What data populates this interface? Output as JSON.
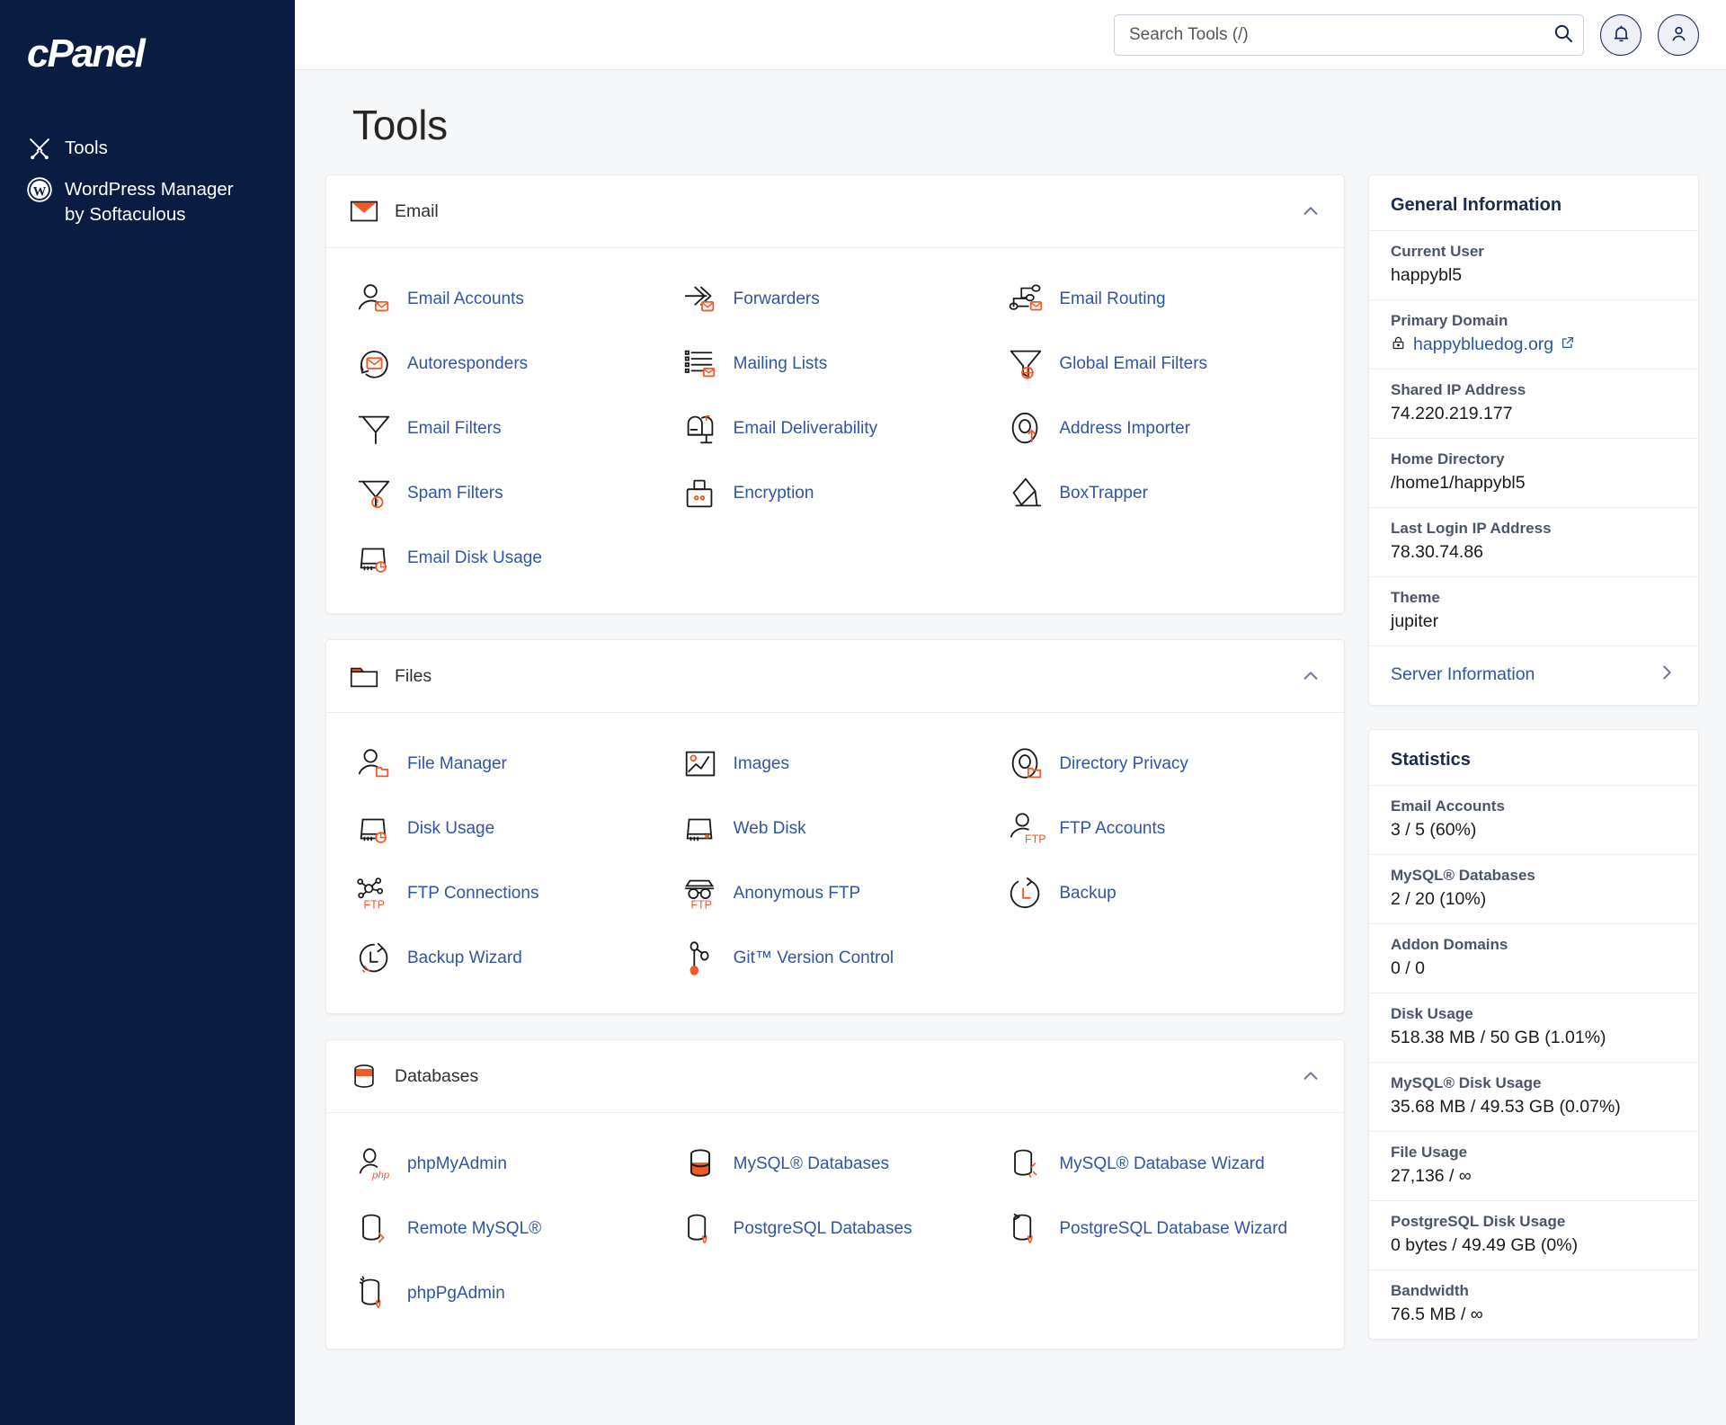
{
  "brand": {
    "name": "cPanel"
  },
  "sidebar": {
    "items": [
      {
        "label": "Tools",
        "icon": "tools-icon",
        "sub": ""
      },
      {
        "label": "WordPress Manager",
        "icon": "wordpress-icon",
        "sub": "by Softaculous"
      }
    ]
  },
  "topbar": {
    "search": {
      "placeholder": "Search Tools (/)",
      "value": "",
      "icon": "search-icon"
    },
    "notifications_icon": "bell-icon",
    "account_icon": "user-icon"
  },
  "page": {
    "title": "Tools"
  },
  "sections": [
    {
      "id": "email",
      "title": "Email",
      "icon": "envelope-icon",
      "collapse_icon": "chevron-up-icon",
      "tools": [
        {
          "label": "Email Accounts",
          "icon": "email-accounts-icon"
        },
        {
          "label": "Forwarders",
          "icon": "forwarders-icon"
        },
        {
          "label": "Email Routing",
          "icon": "email-routing-icon"
        },
        {
          "label": "Autoresponders",
          "icon": "autoresponders-icon"
        },
        {
          "label": "Mailing Lists",
          "icon": "mailing-lists-icon"
        },
        {
          "label": "Global Email Filters",
          "icon": "global-email-filters-icon"
        },
        {
          "label": "Email Filters",
          "icon": "email-filters-icon"
        },
        {
          "label": "Email Deliverability",
          "icon": "email-deliverability-icon"
        },
        {
          "label": "Address Importer",
          "icon": "address-importer-icon"
        },
        {
          "label": "Spam Filters",
          "icon": "spam-filters-icon"
        },
        {
          "label": "Encryption",
          "icon": "encryption-icon"
        },
        {
          "label": "BoxTrapper",
          "icon": "boxtrapper-icon"
        },
        {
          "label": "Email Disk Usage",
          "icon": "email-disk-usage-icon"
        }
      ]
    },
    {
      "id": "files",
      "title": "Files",
      "icon": "folder-icon",
      "collapse_icon": "chevron-up-icon",
      "tools": [
        {
          "label": "File Manager",
          "icon": "file-manager-icon"
        },
        {
          "label": "Images",
          "icon": "images-icon"
        },
        {
          "label": "Directory Privacy",
          "icon": "directory-privacy-icon"
        },
        {
          "label": "Disk Usage",
          "icon": "disk-usage-icon"
        },
        {
          "label": "Web Disk",
          "icon": "web-disk-icon"
        },
        {
          "label": "FTP Accounts",
          "icon": "ftp-accounts-icon"
        },
        {
          "label": "FTP Connections",
          "icon": "ftp-connections-icon"
        },
        {
          "label": "Anonymous FTP",
          "icon": "anonymous-ftp-icon"
        },
        {
          "label": "Backup",
          "icon": "backup-icon"
        },
        {
          "label": "Backup Wizard",
          "icon": "backup-wizard-icon"
        },
        {
          "label": "Git™ Version Control",
          "icon": "git-version-control-icon"
        }
      ]
    },
    {
      "id": "databases",
      "title": "Databases",
      "icon": "database-icon",
      "collapse_icon": "chevron-up-icon",
      "tools": [
        {
          "label": "phpMyAdmin",
          "icon": "phpmyadmin-icon"
        },
        {
          "label": "MySQL® Databases",
          "icon": "mysql-databases-icon"
        },
        {
          "label": "MySQL® Database Wizard",
          "icon": "mysql-database-wizard-icon"
        },
        {
          "label": "Remote MySQL®",
          "icon": "remote-mysql-icon"
        },
        {
          "label": "PostgreSQL Databases",
          "icon": "postgresql-databases-icon"
        },
        {
          "label": "PostgreSQL Database Wizard",
          "icon": "postgresql-database-wizard-icon"
        },
        {
          "label": "phpPgAdmin",
          "icon": "phppgadmin-icon"
        }
      ]
    }
  ],
  "general_information": {
    "title": "General Information",
    "rows": [
      {
        "label": "Current User",
        "value": "happybl5",
        "type": "text"
      },
      {
        "label": "Primary Domain",
        "value": "happybluedog.org",
        "type": "link",
        "lock_icon": "lock-icon",
        "external_icon": "external-link-icon"
      },
      {
        "label": "Shared IP Address",
        "value": "74.220.219.177",
        "type": "text"
      },
      {
        "label": "Home Directory",
        "value": "/home1/happybl5",
        "type": "text"
      },
      {
        "label": "Last Login IP Address",
        "value": "78.30.74.86",
        "type": "text"
      },
      {
        "label": "Theme",
        "value": "jupiter",
        "type": "text"
      }
    ],
    "link": {
      "label": "Server Information",
      "icon": "chevron-right-icon"
    }
  },
  "statistics": {
    "title": "Statistics",
    "rows": [
      {
        "label": "Email Accounts",
        "value": "3 / 5   (60%)"
      },
      {
        "label": "MySQL® Databases",
        "value": "2 / 20   (10%)"
      },
      {
        "label": "Addon Domains",
        "value": "0 / 0"
      },
      {
        "label": "Disk Usage",
        "value": "518.38 MB / 50 GB   (1.01%)"
      },
      {
        "label": "MySQL® Disk Usage",
        "value": "35.68 MB / 49.53 GB   (0.07%)"
      },
      {
        "label": "File Usage",
        "value": "27,136 / ∞"
      },
      {
        "label": "PostgreSQL Disk Usage",
        "value": "0 bytes / 49.49 GB   (0%)"
      },
      {
        "label": "Bandwidth",
        "value": "76.5 MB / ∞"
      }
    ]
  },
  "colors": {
    "sidebar_bg": "#0b1c42",
    "accent_orange": "#f05a28",
    "link_blue": "#2f55a4",
    "page_bg": "#f6f7f9"
  }
}
